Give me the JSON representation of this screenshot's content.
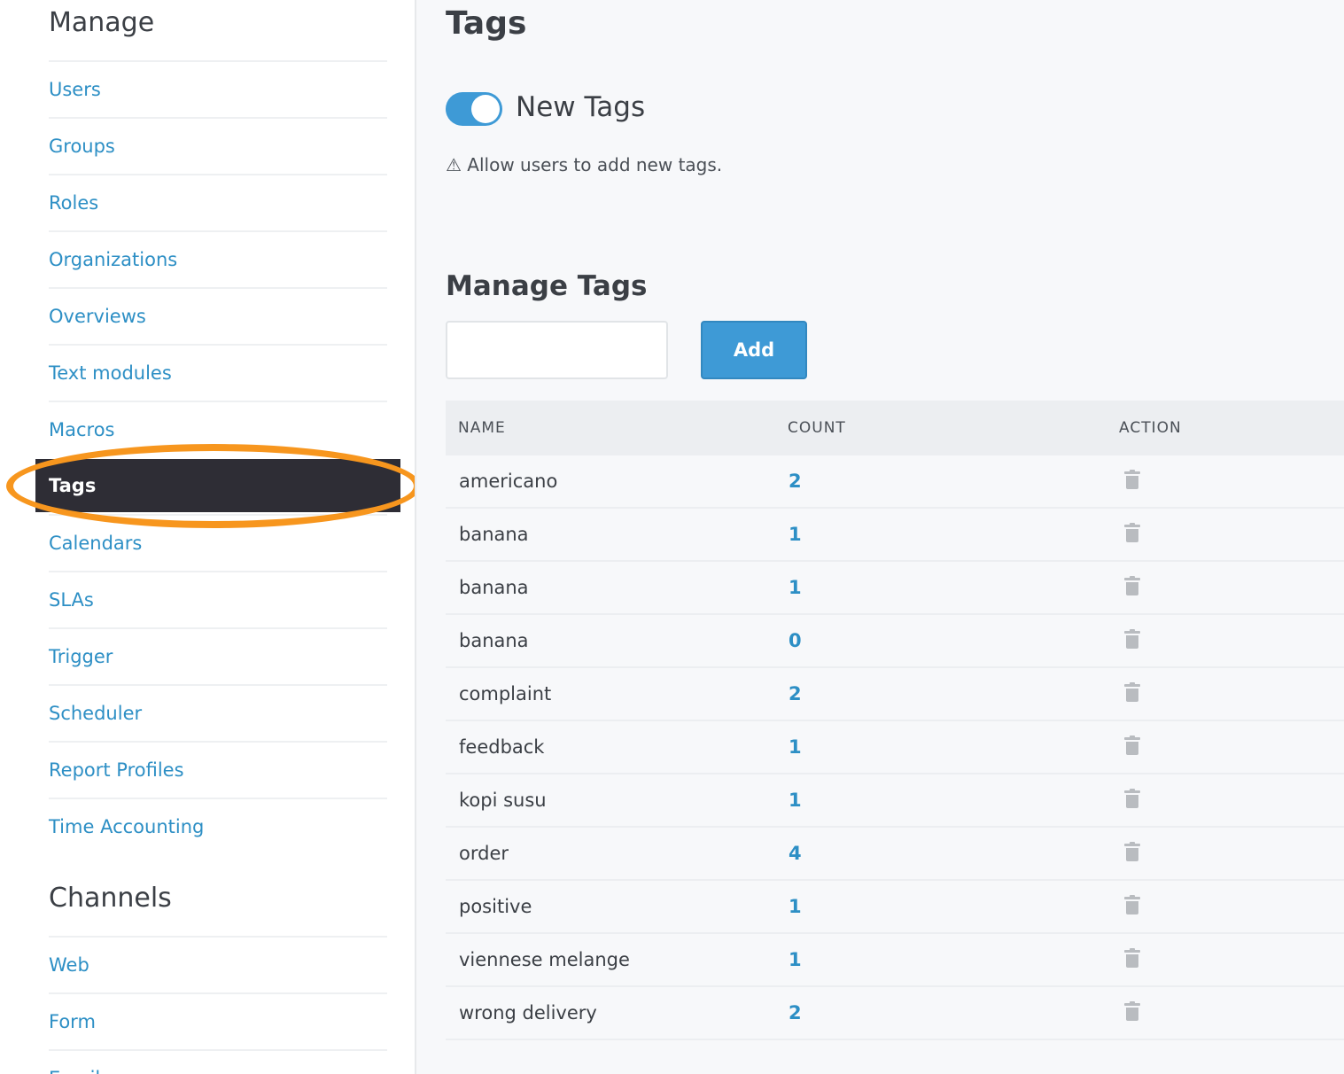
{
  "sidebar": {
    "manage_title": "Manage",
    "manage_items": [
      {
        "label": "Users"
      },
      {
        "label": "Groups"
      },
      {
        "label": "Roles"
      },
      {
        "label": "Organizations"
      },
      {
        "label": "Overviews"
      },
      {
        "label": "Text modules"
      },
      {
        "label": "Macros"
      },
      {
        "label": "Tags",
        "active": true
      },
      {
        "label": "Calendars"
      },
      {
        "label": "SLAs"
      },
      {
        "label": "Trigger"
      },
      {
        "label": "Scheduler"
      },
      {
        "label": "Report Profiles"
      },
      {
        "label": "Time Accounting"
      }
    ],
    "channels_title": "Channels",
    "channel_items": [
      {
        "label": "Web"
      },
      {
        "label": "Form"
      },
      {
        "label": "Email"
      }
    ]
  },
  "main": {
    "title": "Tags",
    "new_tags": {
      "label": "New Tags",
      "enabled": true,
      "hint": "⚠ Allow users to add new tags."
    },
    "manage_tags": {
      "title": "Manage Tags",
      "input_value": "",
      "add_label": "Add"
    },
    "table": {
      "headers": {
        "name": "NAME",
        "count": "COUNT",
        "action": "ACTION"
      },
      "rows": [
        {
          "name": "americano",
          "count": "2"
        },
        {
          "name": "banana",
          "count": "1"
        },
        {
          "name": "banana",
          "count": "1"
        },
        {
          "name": "banana",
          "count": "0"
        },
        {
          "name": "complaint",
          "count": "2"
        },
        {
          "name": "feedback",
          "count": "1"
        },
        {
          "name": "kopi susu",
          "count": "1"
        },
        {
          "name": "order",
          "count": "4"
        },
        {
          "name": "positive",
          "count": "1"
        },
        {
          "name": "viennese melange",
          "count": "1"
        },
        {
          "name": "wrong delivery",
          "count": "2"
        }
      ]
    }
  },
  "colors": {
    "accent": "#3e9ad6",
    "link": "#2d8fc5",
    "active_bg": "#2e2d35",
    "highlight": "#f7961e"
  },
  "icons": {
    "warning": "warning-icon",
    "delete": "trash-icon"
  }
}
